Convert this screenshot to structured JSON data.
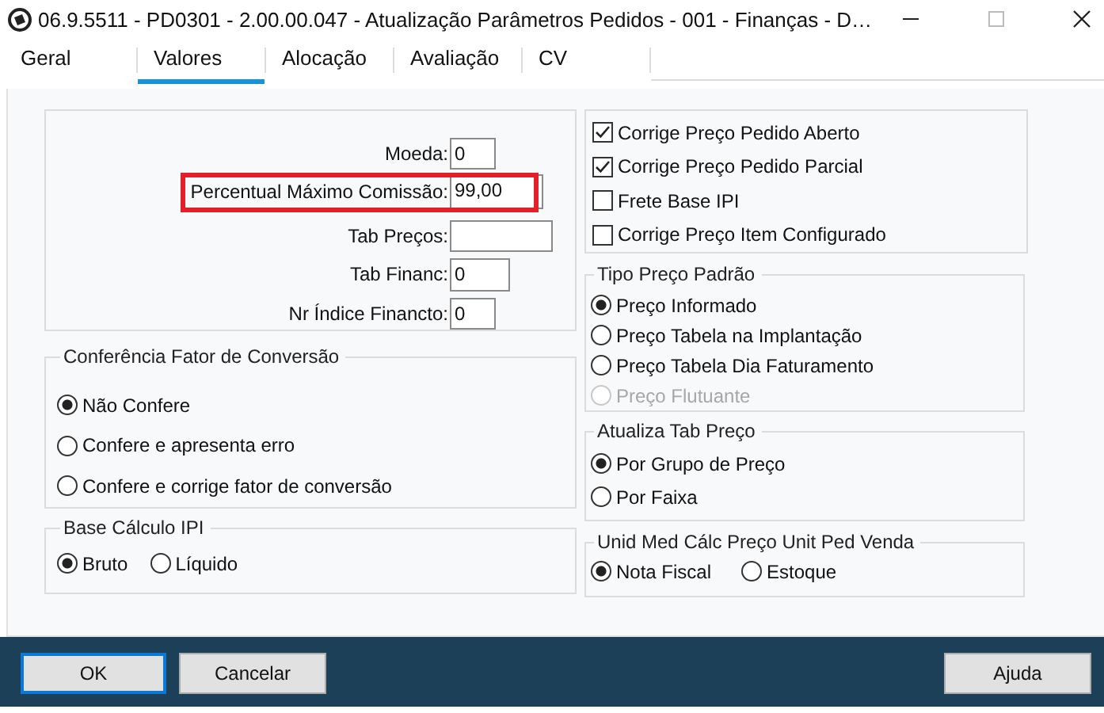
{
  "window": {
    "title": "06.9.5511 - PD0301 - 2.00.00.047 - Atualização Parâmetros Pedidos - 001 - Finanças - D…"
  },
  "tabs": [
    {
      "label": "Geral",
      "selected": false
    },
    {
      "label": "Valores",
      "selected": true
    },
    {
      "label": "Alocação",
      "selected": false
    },
    {
      "label": "Avaliação",
      "selected": false
    },
    {
      "label": "CV",
      "selected": false
    }
  ],
  "left_column": {
    "fields": [
      {
        "label": "Moeda:",
        "value": "0",
        "highlighted": false
      },
      {
        "label": "Percentual Máximo Comissão:",
        "value": "99,00",
        "highlighted": true
      },
      {
        "label": "Tab Preços:",
        "highlighted": false
      },
      {
        "label": "Tab Financ:",
        "value": "0",
        "highlighted": false
      },
      {
        "label": "Nr Índice Financto:",
        "value": "0",
        "highlighted": false
      }
    ],
    "groups": [
      {
        "title": "Conferência Fator de Conversão",
        "kind": "column",
        "options": [
          {
            "label": "Não Confere",
            "selected": true
          },
          {
            "label": "Confere e apresenta erro",
            "selected": false
          },
          {
            "label": "Confere e corrige fator de conversão",
            "selected": false
          }
        ]
      },
      {
        "title": "Base Cálculo IPI",
        "kind": "row",
        "options": [
          {
            "label": "Bruto",
            "selected": true
          },
          {
            "label": "Líquido",
            "selected": false
          }
        ]
      }
    ]
  },
  "right_column": {
    "checkboxes": [
      {
        "label": "Corrige Preço Pedido Aberto",
        "checked": true
      },
      {
        "label": "Corrige Preço Pedido Parcial",
        "checked": true
      },
      {
        "label": "Frete Base IPI",
        "checked": false
      },
      {
        "label": "Corrige Preço Item Configurado",
        "checked": false
      }
    ],
    "groups": [
      {
        "title": "Tipo Preço Padrão",
        "kind": "column",
        "options": [
          {
            "label": "Preço Informado",
            "selected": true,
            "disabled": false
          },
          {
            "label": "Preço Tabela na Implantação",
            "selected": false,
            "disabled": false
          },
          {
            "label": "Preço Tabela Dia Faturamento",
            "selected": false,
            "disabled": false
          },
          {
            "label": "Preço Flutuante",
            "selected": false,
            "disabled": true
          }
        ]
      },
      {
        "title": "Atualiza Tab Preço",
        "kind": "column",
        "options": [
          {
            "label": "Por Grupo de Preço",
            "selected": true
          },
          {
            "label": "Por Faixa",
            "selected": false
          }
        ]
      },
      {
        "title": "Unid Med Cálc Preço Unit Ped Venda",
        "kind": "row",
        "options": [
          {
            "label": "Nota Fiscal",
            "selected": true
          },
          {
            "label": "Estoque",
            "selected": false
          }
        ]
      }
    ]
  },
  "buttons": [
    {
      "label": "OK",
      "focused": true
    },
    {
      "label": "Cancelar",
      "focused": false
    }
  ],
  "help_button": {
    "label": "Ajuda"
  }
}
